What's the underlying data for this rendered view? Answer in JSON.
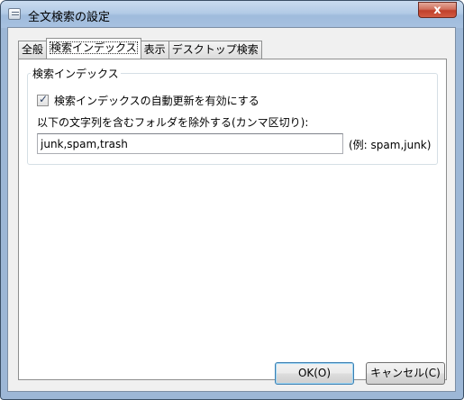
{
  "window": {
    "title": "全文検索の設定",
    "close_label": "x"
  },
  "tabs": [
    {
      "label": "全般"
    },
    {
      "label": "検索インデックス"
    },
    {
      "label": "表示"
    },
    {
      "label": "デスクトップ検索"
    }
  ],
  "index_group": {
    "title": "検索インデックス",
    "auto_update_label": "検索インデックスの自動更新を有効にする",
    "auto_update_checked": true,
    "exclude_label": "以下の文字列を含むフォルダを除外する(カンマ区切り):",
    "exclude_value": "junk,spam,trash",
    "exclude_hint": "(例: spam,junk)"
  },
  "buttons": {
    "ok": "OK(O)",
    "cancel": "キャンセル(C)"
  }
}
